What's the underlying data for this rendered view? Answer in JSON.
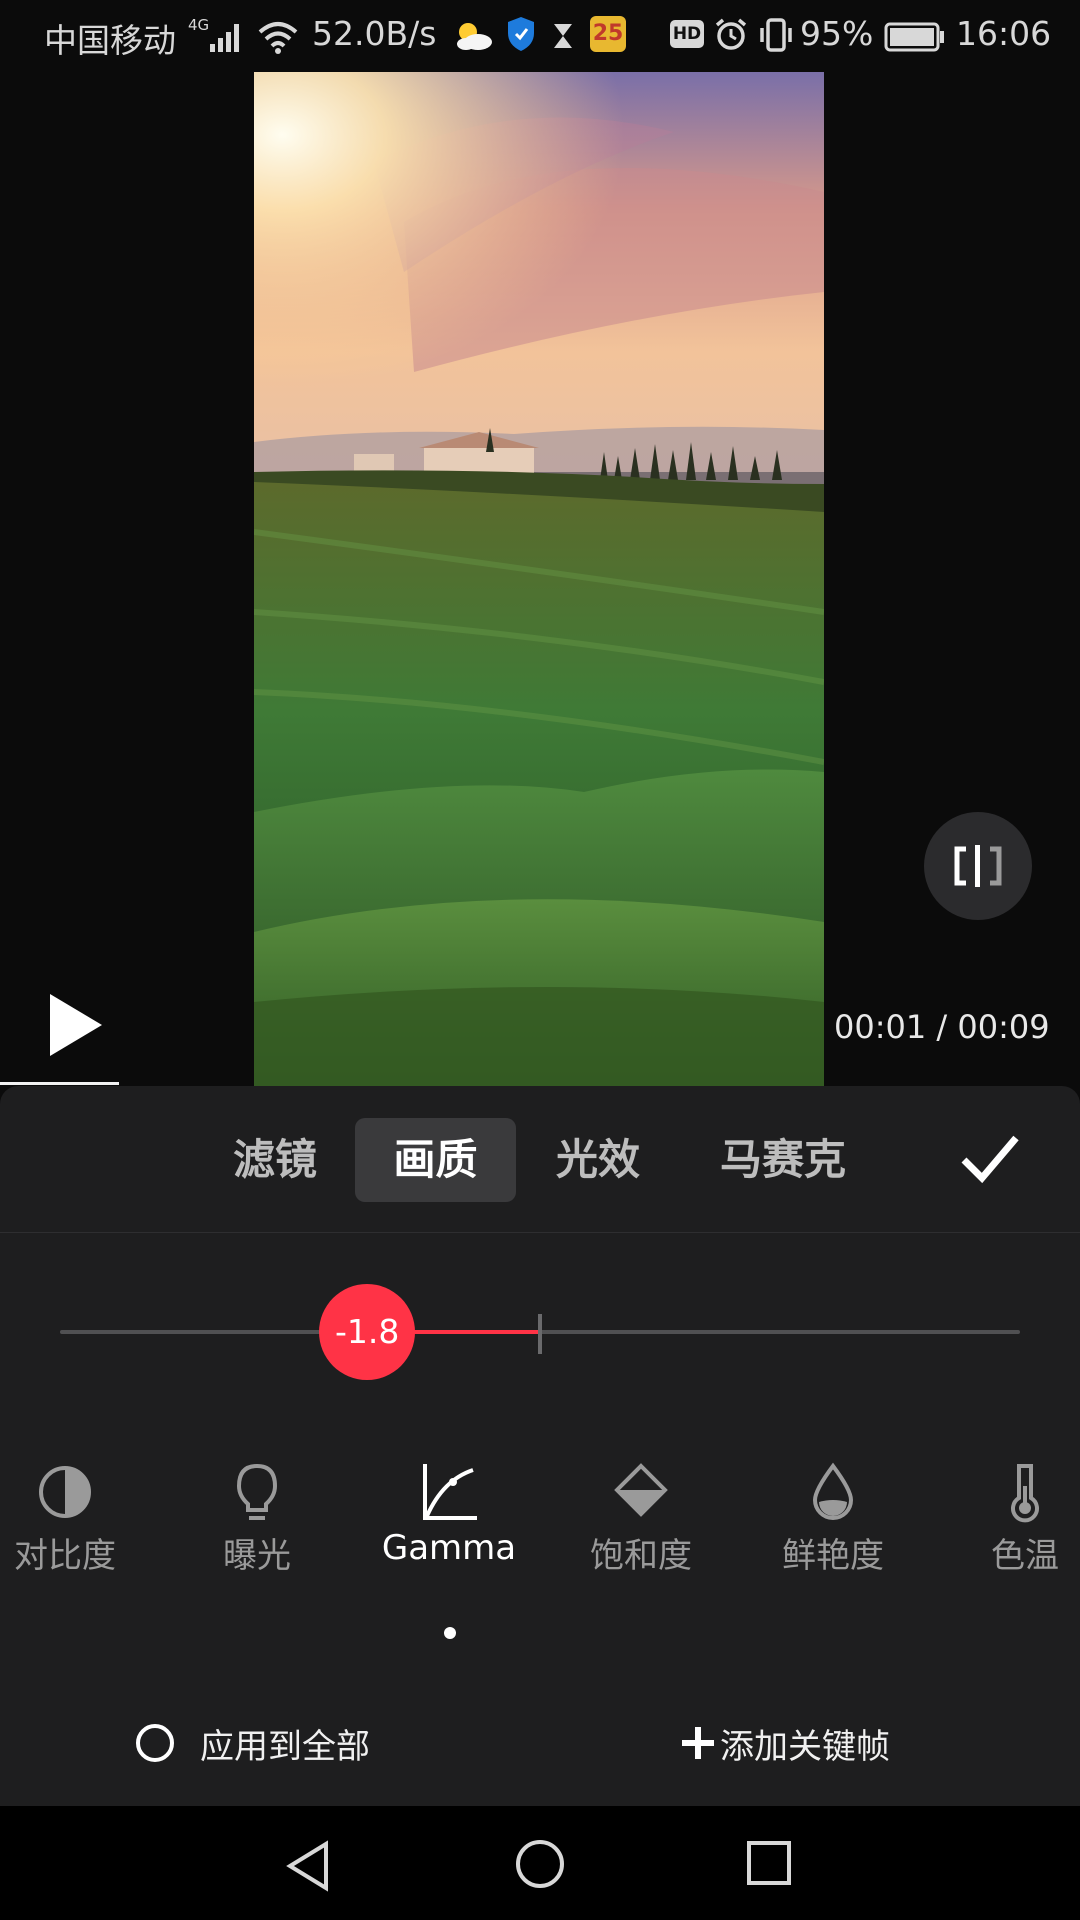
{
  "status_bar": {
    "carrier": "中国移动",
    "network_type": "4G",
    "net_speed": "52.0B/s",
    "calendar_badge": "25",
    "hd_badge": "HD",
    "battery": "95%",
    "time": "16:06",
    "icons": [
      "signal-icon",
      "wifi-icon",
      "weather-icon",
      "shield-icon",
      "hourglass-icon",
      "calendar-app-icon",
      "alarm-icon",
      "vibrate-icon",
      "battery-icon"
    ]
  },
  "player": {
    "timecode": "00:01 / 00:09",
    "playback_progress": 0.11,
    "icons": [
      "play-icon",
      "compare-icon"
    ]
  },
  "tabs": [
    {
      "label": "滤镜",
      "active": false
    },
    {
      "label": "画质",
      "active": true
    },
    {
      "label": "光效",
      "active": false
    },
    {
      "label": "马赛克",
      "active": false
    }
  ],
  "slider": {
    "value": "-1.8",
    "value_fraction": 0.32,
    "center_fraction": 0.5,
    "fill_color": "#ff3346"
  },
  "tools": [
    {
      "label": "对比度",
      "icon": "contrast-icon",
      "active": false
    },
    {
      "label": "曝光",
      "icon": "lightbulb-icon",
      "active": false
    },
    {
      "label": "Gamma",
      "icon": "gamma-curve-icon",
      "active": true
    },
    {
      "label": "饱和度",
      "icon": "saturation-icon",
      "active": false
    },
    {
      "label": "鲜艳度",
      "icon": "vibrance-drop-icon",
      "active": false
    },
    {
      "label": "色温",
      "icon": "thermometer-icon",
      "active": false
    }
  ],
  "options": {
    "apply_all": "应用到全部",
    "add_keyframe": "添加关键帧"
  },
  "navigation": [
    "back-icon",
    "home-icon",
    "recents-icon"
  ]
}
